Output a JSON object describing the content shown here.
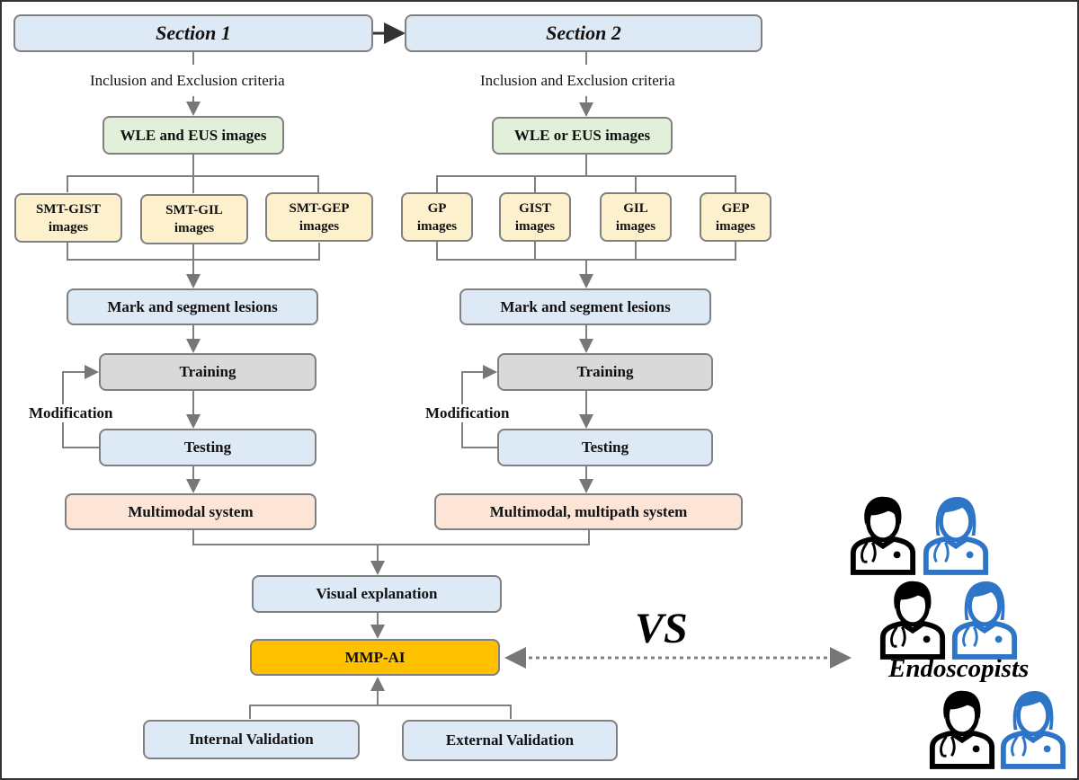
{
  "section1": {
    "title": "Section 1",
    "criteria": "Inclusion and Exclusion criteria",
    "images": "WLE and EUS images",
    "classes": [
      "SMT-GIST images",
      "SMT-GIL images",
      "SMT-GEP images"
    ],
    "mark": "Mark and segment lesions",
    "training": "Training",
    "modification": "Modification",
    "testing": "Testing",
    "system": "Multimodal system"
  },
  "section2": {
    "title": "Section 2",
    "criteria": "Inclusion and Exclusion criteria",
    "images": "WLE or EUS images",
    "classes": [
      "GP images",
      "GIST images",
      "GIL images",
      "GEP images"
    ],
    "mark": "Mark and segment lesions",
    "training": "Training",
    "modification": "Modification",
    "testing": "Testing",
    "system": "Multimodal, multipath system"
  },
  "visual_explanation": "Visual explanation",
  "model": "MMP-AI",
  "validation": {
    "internal": "Internal Validation",
    "external": "External Validation"
  },
  "comparison": {
    "vs": "VS",
    "group": "Endoscopists"
  },
  "colors": {
    "box_blue": "#dee9f6",
    "box_green": "#e2f0d9",
    "box_yellow": "#fdf0cd",
    "box_gray": "#d9d9d9",
    "box_peach": "#fce4d6",
    "model_gold": "#ffc000",
    "doctor_black": "#000000",
    "doctor_blue": "#2e75c8"
  },
  "icons": [
    "doctor-male-icon",
    "doctor-female-icon"
  ]
}
